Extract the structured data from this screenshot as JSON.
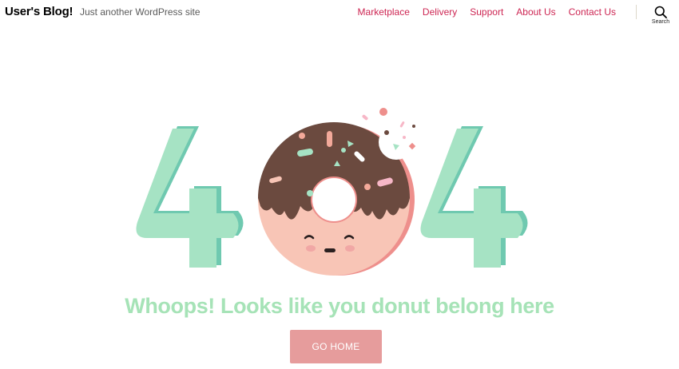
{
  "header": {
    "site_title": "User's Blog!",
    "tagline": "Just another WordPress site",
    "nav": [
      "Marketplace",
      "Delivery",
      "Support",
      "About Us",
      "Contact Us"
    ],
    "search_label": "Search",
    "search_icon": "search-icon"
  },
  "main": {
    "headline": "Whoops! Looks like you donut belong here",
    "button_label": "GO HOME"
  },
  "colors": {
    "nav_link": "#cd2653",
    "headline": "#a6e3b7",
    "button": "#e69c9c",
    "digit": "#a6e3c4",
    "digit_shadow": "#6fc9b0",
    "icing": "#6b4a3f",
    "dough": "#f8c5b6"
  }
}
